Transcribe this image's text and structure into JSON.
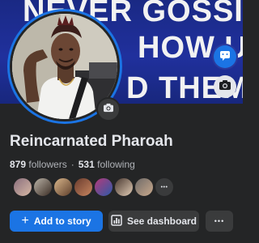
{
  "cover": {
    "lines": [
      "NEVER GOSSIP",
      "HOW U",
      "D THEM"
    ]
  },
  "profile": {
    "name": "Reincarnated Pharoah",
    "followers_count": "879",
    "followers_label": "followers",
    "separator": "·",
    "following_count": "531",
    "following_label": "following",
    "friend_avatar_count": 8,
    "more_friends_glyph": "•••"
  },
  "actions": {
    "add_to_story_icon": "+",
    "add_to_story_label": "Add to story",
    "dashboard_label": "See dashboard",
    "more_glyph": "•••"
  },
  "colors": {
    "background": "#242526",
    "primary": "#1b74e4",
    "secondary_button": "#3a3b3c",
    "text": "#e4e6eb",
    "muted_text": "#b0b3b8",
    "cover_blue": "#2233a6"
  },
  "icons": [
    "messenger-icon",
    "camera-icon",
    "plus-icon",
    "dashboard-icon",
    "more-icon"
  ]
}
